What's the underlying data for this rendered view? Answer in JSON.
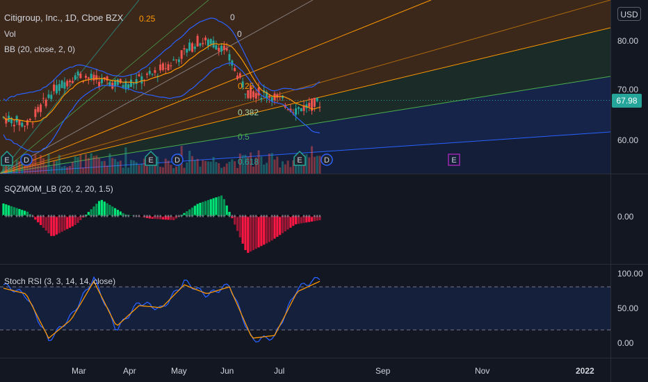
{
  "header": {
    "symbol": "Citigroup, Inc., 1D, Cboe BZX",
    "vol": "Vol",
    "bb": "BB (20, close, 2, 0)",
    "sqz": "SQZMOM_LB (20, 2, 20, 1.5)",
    "stoch": "Stoch RSI (3, 3, 14, 14, close)",
    "currency": "USD"
  },
  "price_axis": {
    "labels": [
      "80.00",
      "70.00",
      "60.00"
    ],
    "current": "67.98"
  },
  "sqz_axis": {
    "labels": [
      "0.00"
    ]
  },
  "stoch_axis": {
    "labels": [
      "100.00",
      "50.00",
      "0.00"
    ]
  },
  "time_axis": {
    "labels": [
      "Mar",
      "Apr",
      "May",
      "Jun",
      "Jul",
      "Sep",
      "Nov",
      "2022"
    ]
  },
  "fib_labels": [
    "0.25",
    "0",
    "0",
    "0.25",
    "0.382",
    "0.5",
    "0.618"
  ],
  "event_markers": [
    "E",
    "D",
    "E",
    "D",
    "E",
    "D",
    "E"
  ],
  "colors": {
    "up": "#26a69a",
    "down": "#ef5350",
    "bb": "#2962ff",
    "basis": "#ff9800",
    "stochK": "#2962ff",
    "stochD": "#ff9800",
    "sqzUp": "#00e676",
    "sqzDn": "#ff1744"
  },
  "chart_data": [
    {
      "type": "line",
      "title": "Citigroup, Inc., 1D, Cboe BZX",
      "ylim": [
        54,
        88
      ],
      "series": [
        {
          "name": "close",
          "x": [
            "Feb 1",
            "Feb 15",
            "Mar 1",
            "Mar 15",
            "Apr 1",
            "Apr 15",
            "May 1",
            "May 15",
            "Jun 1",
            "Jun 10",
            "Jun 20",
            "Jul 1",
            "Jul 10",
            "Jul 20"
          ],
          "values": [
            65.0,
            63.5,
            70.0,
            73.5,
            72.0,
            71.5,
            73.0,
            76.0,
            80.0,
            79.0,
            70.0,
            69.5,
            66.5,
            67.98
          ]
        }
      ]
    },
    {
      "type": "bar",
      "title": "SQZMOM_LB (20, 2, 20, 1.5)",
      "series": [
        {
          "name": "momentum",
          "x": [
            "Feb 1",
            "Feb 10",
            "Feb 20",
            "Mar 1",
            "Mar 15",
            "Apr 1",
            "Apr 15",
            "May 1",
            "May 15",
            "Jun 1",
            "Jun 15",
            "Jun 25",
            "Jul 5",
            "Jul 15"
          ],
          "values": [
            1.5,
            0.5,
            -2.5,
            -1.0,
            2.0,
            0.2,
            -0.3,
            -0.5,
            1.5,
            2.5,
            -4.5,
            -3.0,
            -1.0,
            -0.5
          ]
        }
      ]
    },
    {
      "type": "line",
      "title": "Stoch RSI (3, 3, 14, 14, close)",
      "ylim": [
        0,
        100
      ],
      "series": [
        {
          "name": "K",
          "x": [
            "Feb 1",
            "Feb 10",
            "Feb 20",
            "Mar 1",
            "Mar 15",
            "Apr 1",
            "Apr 15",
            "May 1",
            "May 15",
            "Jun 1",
            "Jun 10",
            "Jun 20",
            "Jul 1",
            "Jul 10",
            "Jul 20"
          ],
          "values": [
            85,
            70,
            5,
            40,
            95,
            20,
            60,
            50,
            90,
            70,
            85,
            5,
            10,
            80,
            95
          ]
        },
        {
          "name": "D",
          "x": [
            "Feb 1",
            "Feb 10",
            "Feb 20",
            "Mar 1",
            "Mar 15",
            "Apr 1",
            "Apr 15",
            "May 1",
            "May 15",
            "Jun 1",
            "Jun 10",
            "Jun 20",
            "Jul 1",
            "Jul 10",
            "Jul 20"
          ],
          "values": [
            80,
            72,
            8,
            35,
            90,
            25,
            55,
            52,
            85,
            72,
            82,
            8,
            12,
            75,
            90
          ]
        }
      ]
    }
  ]
}
